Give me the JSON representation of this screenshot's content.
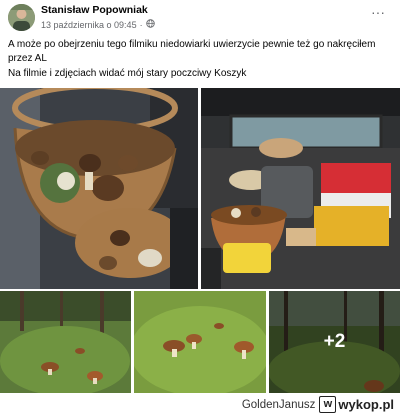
{
  "post": {
    "author": "Stanisław Popowniak",
    "date": "13 października o 09:45",
    "separator": "·",
    "more_label": "···",
    "text_line1": "A może po obejrzeniu tego filmiku niedowiarki uwierzycie pewnie też go nakręciłem przez AL",
    "text_line2": "Na filmie i zdjęciach widać mój stary poczciwy Koszyk",
    "extra_photos": "+2"
  },
  "watermark": {
    "username": "GoldenJanusz",
    "logo_letter": "w",
    "site": "wykop.pl"
  },
  "icons": {
    "globe": "globe-icon",
    "more": "more-options-icon"
  }
}
